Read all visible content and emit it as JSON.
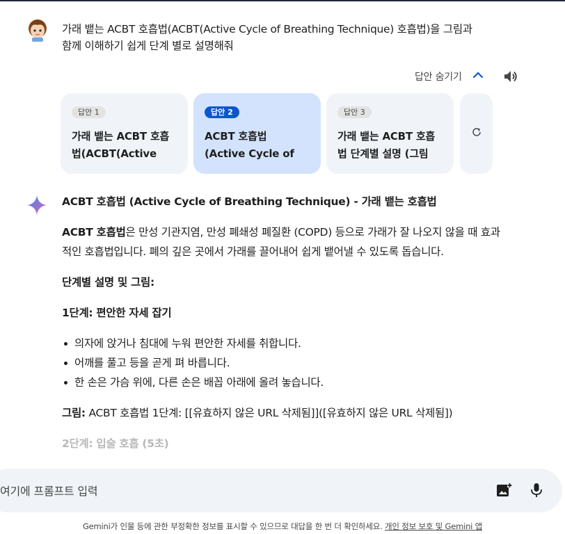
{
  "user": {
    "prompt_line1": "가래 뱉는 ACBT 호흡법(ACBT(Active Cycle of Breathing Technique) 호흡법)을 그림과",
    "prompt_line2": "함께 이해하기 쉽게 단계 별로 설명해줘"
  },
  "drafts": {
    "toggle_label": "답안 숨기기",
    "cards": [
      {
        "badge": "답안 1",
        "text": "가래 뱉는 ACBT 호흡법(ACBT(Active"
      },
      {
        "badge": "답안 2",
        "text": "ACBT 호흡법 (Active Cycle of"
      },
      {
        "badge": "답안 3",
        "text": "가래 뱉는 ACBT 호흡법 단계별 설명 (그림"
      }
    ]
  },
  "response": {
    "title": "ACBT 호흡법 (Active Cycle of Breathing Technique) - 가래 뱉는 호흡법",
    "intro_bold": "ACBT 호흡법",
    "intro_rest": "은 만성 기관지염, 만성 폐쇄성 폐질환 (COPD) 등으로 가래가 잘 나오지 않을 때 효과적인 호흡법입니다. 폐의 깊은 곳에서 가래를 끌어내어 쉽게 뱉어낼 수 있도록 돕습니다.",
    "section_heading": "단계별 설명 및 그림:",
    "step1_heading": "1단계: 편안한 자세 잡기",
    "step1_items": [
      "의자에 앉거나 침대에 누워 편안한 자세를 취합니다.",
      "어깨를 풀고 등을 곧게 펴 바릅니다.",
      "한 손은 가슴 위에, 다른 손은 배꼽 아래에 올려 놓습니다."
    ],
    "figure_label": "그림:",
    "figure_text": " ACBT 호흡법 1단계: [[유효하지 않은 URL 삭제됨]]([유효하지 않은 URL 삭제됨])",
    "step2_heading": "2단계: 입술 호흡 (5초)"
  },
  "input": {
    "placeholder": "여기에 프롬프트 입력"
  },
  "footer": {
    "disclaimer": "Gemini가 인물 등에 관한 부정확한 정보를 표시할 수 있으므로 대답을 한 번 더 확인하세요. ",
    "link": "개인 정보 보호 및 Gemini 앱"
  },
  "colors": {
    "accent": "#0b57d0",
    "card_bg": "#f0f4f9",
    "card_active_bg": "#d3e3fd"
  }
}
